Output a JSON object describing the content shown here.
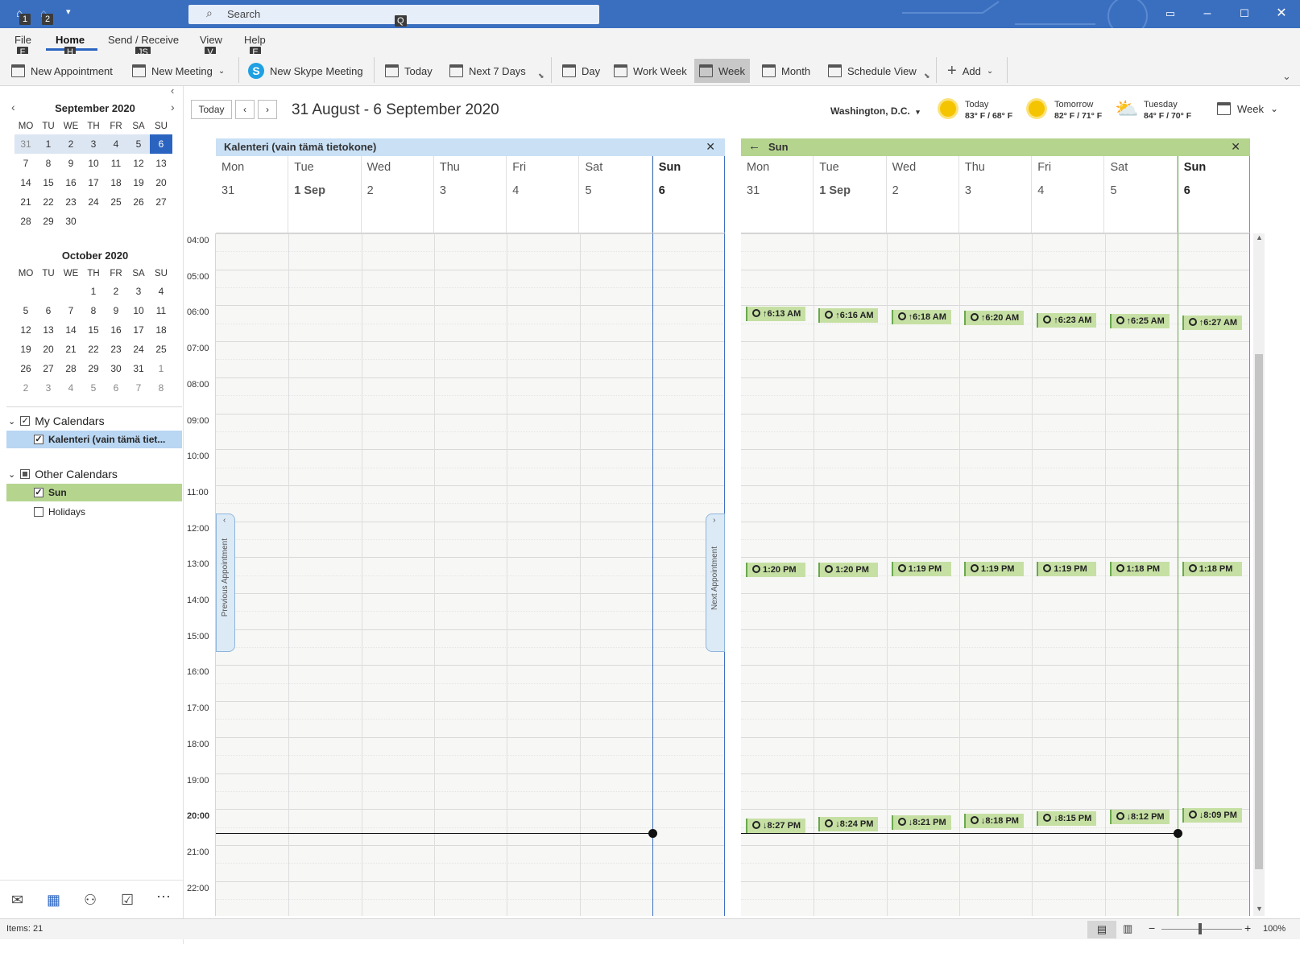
{
  "app": {
    "search_placeholder": "Search"
  },
  "keytips": {
    "qat1": "1",
    "qat2": "2",
    "search": "Q",
    "file": "F",
    "home": "H",
    "send": "JS",
    "view": "V",
    "help": "E"
  },
  "ribbon_tabs": [
    {
      "label": "File"
    },
    {
      "label": "Home"
    },
    {
      "label": "Send / Receive"
    },
    {
      "label": "View"
    },
    {
      "label": "Help"
    }
  ],
  "ribbon": {
    "new_appointment": "New Appointment",
    "new_meeting": "New Meeting",
    "new_skype_meeting": "New Skype Meeting",
    "today": "Today",
    "next7": "Next 7 Days",
    "day": "Day",
    "work_week": "Work Week",
    "week": "Week",
    "month": "Month",
    "schedule": "Schedule View",
    "add": "Add"
  },
  "minical": {
    "weekdays": [
      "MO",
      "TU",
      "WE",
      "TH",
      "FR",
      "SA",
      "SU"
    ],
    "sep": {
      "title": "September 2020",
      "days": [
        [
          "31",
          "cw om"
        ],
        [
          "1",
          "cw"
        ],
        [
          "2",
          "cw"
        ],
        [
          "3",
          "cw"
        ],
        [
          "4",
          "cw"
        ],
        [
          "5",
          "cw"
        ],
        [
          "6",
          "td"
        ],
        [
          "7",
          ""
        ],
        [
          "8",
          ""
        ],
        [
          "9",
          ""
        ],
        [
          "10",
          ""
        ],
        [
          "11",
          ""
        ],
        [
          "12",
          ""
        ],
        [
          "13",
          ""
        ],
        [
          "14",
          ""
        ],
        [
          "15",
          ""
        ],
        [
          "16",
          ""
        ],
        [
          "17",
          ""
        ],
        [
          "18",
          ""
        ],
        [
          "19",
          ""
        ],
        [
          "20",
          ""
        ],
        [
          "21",
          ""
        ],
        [
          "22",
          ""
        ],
        [
          "23",
          ""
        ],
        [
          "24",
          ""
        ],
        [
          "25",
          ""
        ],
        [
          "26",
          ""
        ],
        [
          "27",
          ""
        ],
        [
          "28",
          ""
        ],
        [
          "29",
          ""
        ],
        [
          "30",
          ""
        ],
        [
          "",
          ""
        ],
        [
          "",
          ""
        ],
        [
          "",
          ""
        ],
        [
          "",
          ""
        ]
      ]
    },
    "oct": {
      "title": "October 2020",
      "days": [
        [
          "",
          ""
        ],
        [
          "",
          ""
        ],
        [
          "",
          ""
        ],
        [
          "1",
          ""
        ],
        [
          "2",
          ""
        ],
        [
          "3",
          ""
        ],
        [
          "4",
          ""
        ],
        [
          "5",
          ""
        ],
        [
          "6",
          ""
        ],
        [
          "7",
          ""
        ],
        [
          "8",
          ""
        ],
        [
          "9",
          ""
        ],
        [
          "10",
          ""
        ],
        [
          "11",
          ""
        ],
        [
          "12",
          ""
        ],
        [
          "13",
          ""
        ],
        [
          "14",
          ""
        ],
        [
          "15",
          ""
        ],
        [
          "16",
          ""
        ],
        [
          "17",
          ""
        ],
        [
          "18",
          ""
        ],
        [
          "19",
          ""
        ],
        [
          "20",
          ""
        ],
        [
          "21",
          ""
        ],
        [
          "22",
          ""
        ],
        [
          "23",
          ""
        ],
        [
          "24",
          ""
        ],
        [
          "25",
          ""
        ],
        [
          "26",
          ""
        ],
        [
          "27",
          ""
        ],
        [
          "28",
          ""
        ],
        [
          "29",
          ""
        ],
        [
          "30",
          ""
        ],
        [
          "31",
          ""
        ],
        [
          "1",
          "om"
        ],
        [
          "2",
          "om"
        ],
        [
          "3",
          "om"
        ],
        [
          "4",
          "om"
        ],
        [
          "5",
          "om"
        ],
        [
          "6",
          "om"
        ],
        [
          "7",
          "om"
        ],
        [
          "8",
          "om"
        ]
      ]
    }
  },
  "calendars": {
    "my_group": "My Calendars",
    "my_item": "Kalenteri (vain tämä tiet...",
    "other_group": "Other Calendars",
    "sun": "Sun",
    "holidays": "Holidays"
  },
  "header": {
    "today_btn": "Today",
    "range": "31 August - 6 September 2020",
    "location": "Washington, D.C.",
    "weather": [
      {
        "day": "Today",
        "temp": "83° F / 68° F"
      },
      {
        "day": "Tomorrow",
        "temp": "82° F / 71° F"
      },
      {
        "day": "Tuesday",
        "temp": "84° F / 70° F"
      }
    ],
    "view": "Week"
  },
  "hours": [
    "04:00",
    "05:00",
    "06:00",
    "07:00",
    "08:00",
    "09:00",
    "10:00",
    "11:00",
    "12:00",
    "13:00",
    "14:00",
    "15:00",
    "16:00",
    "17:00",
    "18:00",
    "19:00",
    "20:00",
    "21:00",
    "22:00"
  ],
  "days": [
    {
      "name": "Mon",
      "date": "31"
    },
    {
      "name": "Tue",
      "date": "1 Sep"
    },
    {
      "name": "Wed",
      "date": "2"
    },
    {
      "name": "Thu",
      "date": "3"
    },
    {
      "name": "Fri",
      "date": "4"
    },
    {
      "name": "Sat",
      "date": "5"
    },
    {
      "name": "Sun",
      "date": "6"
    }
  ],
  "pane1": {
    "title": "Kalenteri (vain tämä tietokone)",
    "prev": "Previous Appointment",
    "next": "Next Appointment"
  },
  "pane2": {
    "title": "Sun"
  },
  "sun_events": {
    "sunrise": [
      "6:13 AM",
      "6:16 AM",
      "6:18 AM",
      "6:20 AM",
      "6:23 AM",
      "6:25 AM",
      "6:27 AM"
    ],
    "noon": [
      "1:20 PM",
      "1:20 PM",
      "1:19 PM",
      "1:19 PM",
      "1:19 PM",
      "1:18 PM",
      "1:18 PM"
    ],
    "sunset": [
      "8:27 PM",
      "8:24 PM",
      "8:21 PM",
      "8:18 PM",
      "8:15 PM",
      "8:12 PM",
      "8:09 PM"
    ]
  },
  "status": {
    "items": "Items: 21",
    "zoom": "100%"
  },
  "colors": {
    "accent": "#2b64c0",
    "pane1_head": "#c9e0f5",
    "pane2_head": "#b5d58f",
    "event": "#c6e0a4"
  }
}
